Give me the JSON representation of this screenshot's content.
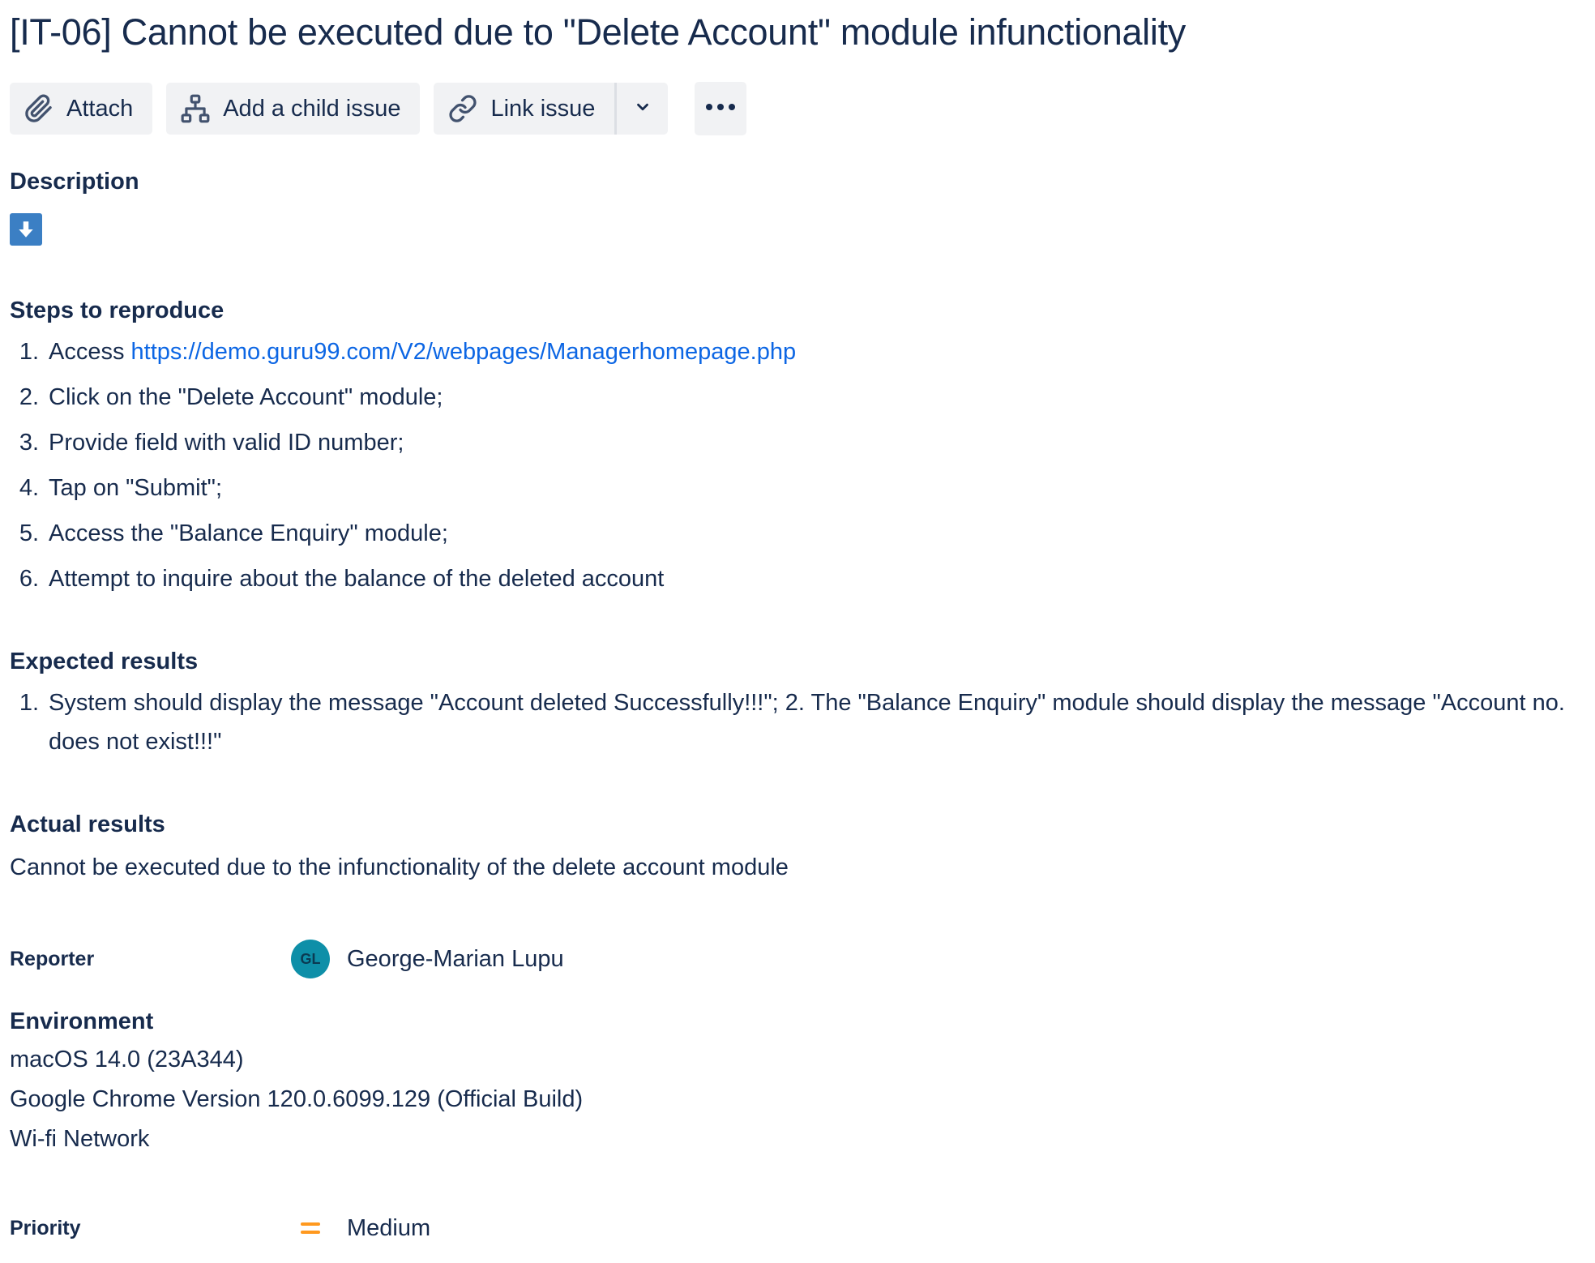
{
  "issue": {
    "title": "[IT-06] Cannot be executed due to \"Delete Account\" module infunctionality"
  },
  "toolbar": {
    "attach_label": "Attach",
    "add_child_label": "Add a child issue",
    "link_issue_label": "Link issue"
  },
  "description": {
    "label": "Description",
    "steps_heading": "Steps to reproduce",
    "steps": [
      {
        "num": "1.",
        "text": "Access ",
        "link": "https://demo.guru99.com/V2/webpages/Managerhomepage.php"
      },
      {
        "num": "2.",
        "text": "Click on the \"Delete Account\" module;"
      },
      {
        "num": "3.",
        "text": "Provide field with valid ID number;"
      },
      {
        "num": "4.",
        "text": "Tap on \"Submit\";"
      },
      {
        "num": "5.",
        "text": "Access the \"Balance Enquiry\" module;"
      },
      {
        "num": "6.",
        "text": "Attempt to inquire about the balance of the deleted account"
      }
    ],
    "expected_heading": "Expected results",
    "expected": [
      {
        "num": "1.",
        "text": "System should display the message \"Account deleted Successfully!!!\"; 2. The \"Balance Enquiry\" module should display the message \"Account no. does not exist!!!\""
      }
    ],
    "actual_heading": "Actual results",
    "actual_text": "Cannot be executed due to the infunctionality of the delete account module"
  },
  "fields": {
    "reporter_label": "Reporter",
    "reporter_initials": "GL",
    "reporter_name": "George-Marian Lupu",
    "environment_label": "Environment",
    "environment_lines": [
      "macOS 14.0 (23A344)",
      "Google Chrome Version 120.0.6099.129 (Official Build)",
      "Wi-fi Network"
    ],
    "priority_label": "Priority",
    "priority_value": "Medium"
  },
  "icons": {
    "attach": "paperclip-icon",
    "add_child": "hierarchy-icon",
    "link": "link-icon",
    "dropdown": "chevron-down-icon",
    "more": "more-horizontal-icon",
    "expand": "arrow-down-icon",
    "priority": "priority-medium-icon"
  },
  "colors": {
    "text": "#172b4d",
    "link": "#0c66e4",
    "button_bg": "#f1f2f4",
    "expand_icon_bg": "#3b7fc4",
    "avatar_bg": "#0e8fa8",
    "priority_medium": "#ff991f"
  }
}
